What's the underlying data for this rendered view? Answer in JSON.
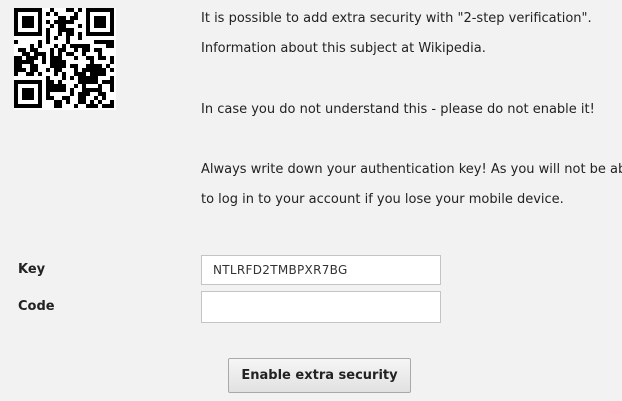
{
  "qr_code": {
    "icon": "qr-code-icon",
    "color": "#000000"
  },
  "info": {
    "line1": "It is possible to add extra security with \"2-step verification\".",
    "line2": "Information about this subject at Wikipedia.",
    "warning": "In case you do not understand this - please do not enable it!",
    "reminder_line1": "Always write down your authentication key! As you will not be able",
    "reminder_line2": "to log in to your account if you lose your mobile device."
  },
  "form": {
    "key_label": "Key",
    "key_value": "NTLRFD2TMBPXR7BG",
    "code_label": "Code",
    "code_value": "",
    "code_placeholder": "",
    "submit_label": "Enable extra security"
  },
  "colors": {
    "background": "#f2f2f2",
    "text": "#222222",
    "field_border": "#c4c4c4"
  }
}
